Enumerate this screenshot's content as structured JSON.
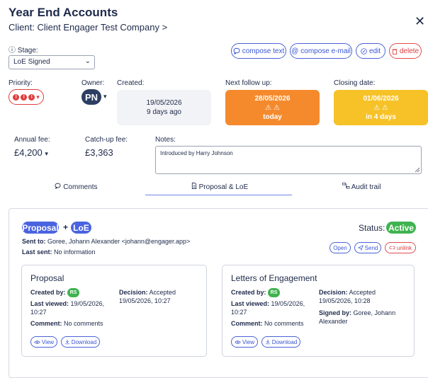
{
  "header": {
    "title": "Year End Accounts",
    "client_prefix": "Client:",
    "client_name": "Client Engager Test Company",
    "client_chevron": ">",
    "close_glyph": "✕"
  },
  "stage": {
    "label": "Stage:",
    "info_glyph": "ⓘ",
    "value": "LoE Signed",
    "chevron": "⌄"
  },
  "actions": {
    "compose_text": "compose text",
    "compose_email": "compose e-mail",
    "edit": "edit",
    "delete": "delete"
  },
  "priority": {
    "label": "Priority:",
    "dots": [
      "!",
      "!",
      "!"
    ],
    "chevron": "▾"
  },
  "owner": {
    "label": "Owner:",
    "initials": "PN",
    "chevron": "▾"
  },
  "created": {
    "label": "Created:",
    "date": "19/05/2026",
    "relative": "9 days ago"
  },
  "next_follow_up": {
    "label": "Next follow up:",
    "date": "28/05/2026",
    "warning": "⚠ ⚠",
    "relative": "today",
    "color": "#f58a2d"
  },
  "closing_date": {
    "label": "Closing date:",
    "date": "01/06/2026",
    "warning": "⚠ ⚠",
    "relative": "in 4 days",
    "color": "#f6c228"
  },
  "annual_fee": {
    "label": "Annual fee:",
    "value": "£4,200",
    "chevron": "▾"
  },
  "catchup_fee": {
    "label": "Catch-up fee:",
    "value": "£3,363"
  },
  "notes": {
    "label": "Notes:",
    "value": "Introduced by Harry Johnson"
  },
  "tabs": [
    {
      "label": "Comments",
      "icon": "speech-bubble"
    },
    {
      "label": "Proposal & LoE",
      "icon": "document",
      "active": true
    },
    {
      "label": "Audit trail",
      "icon": "flow"
    }
  ],
  "proposal_panel": {
    "tag_proposal": "Proposal",
    "plus": "+",
    "tag_loe": "LoE",
    "status_label": "Status:",
    "status_value": "Active",
    "sent_to_label": "Sent to:",
    "sent_to_value": "Goree, Johann Alexander <johann@engager.app>",
    "last_sent_label": "Last sent:",
    "last_sent_value": "No information",
    "buttons": {
      "open": "Open",
      "send": "Send",
      "unlink": "unlink"
    }
  },
  "proposal_doc": {
    "title": "Proposal",
    "created_by_label": "Created by:",
    "created_by": "RS",
    "decision_label": "Decision:",
    "decision": "Accepted",
    "decision_date": "19/05/2026, 10:27",
    "last_viewed_label": "Last viewed:",
    "last_viewed_date": "19/05/2026,",
    "last_viewed_time": "10:27",
    "comment_label": "Comment:",
    "comment": "No comments",
    "view": "View",
    "download": "Download"
  },
  "loe_doc": {
    "title": "Letters of Engagement",
    "created_by_label": "Created by:",
    "created_by": "RS",
    "decision_label": "Decision:",
    "decision": "Accepted",
    "decision_date": "19/05/2026, 10:28",
    "signed_by_label": "Signed by:",
    "signed_by_1": "Goree, Johann",
    "signed_by_2": "Alexander",
    "last_viewed_label": "Last viewed:",
    "last_viewed_date": "19/05/2026,",
    "last_viewed_time": "10:27",
    "comment_label": "Comment:",
    "comment": "No comments",
    "view": "View",
    "download": "Download"
  }
}
